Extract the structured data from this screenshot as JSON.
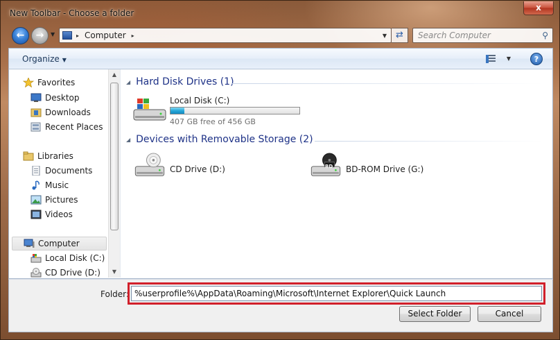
{
  "window": {
    "title": "New Toolbar - Choose a folder",
    "close_label": "x"
  },
  "nav": {
    "back_label": "←",
    "forward_label": "→",
    "history_caret": "▼"
  },
  "address": {
    "crumb": "Computer",
    "arrow": "▸",
    "dropdown": "▼"
  },
  "refresh_icon": "⇄",
  "search": {
    "placeholder": "Search Computer",
    "icon": "search-icon"
  },
  "toolbar": {
    "organize_label": "Organize",
    "caret": "▼",
    "help_label": "?"
  },
  "sidebar": {
    "favorites": [
      {
        "label": "Favorites",
        "icon": "star-icon"
      },
      {
        "label": "Desktop",
        "icon": "desktop-icon"
      },
      {
        "label": "Downloads",
        "icon": "downloads-icon"
      },
      {
        "label": "Recent Places",
        "icon": "recent-places-icon"
      }
    ],
    "libraries": [
      {
        "label": "Libraries",
        "icon": "libraries-icon"
      },
      {
        "label": "Documents",
        "icon": "documents-icon"
      },
      {
        "label": "Music",
        "icon": "music-icon"
      },
      {
        "label": "Pictures",
        "icon": "pictures-icon"
      },
      {
        "label": "Videos",
        "icon": "videos-icon"
      }
    ],
    "computer": [
      {
        "label": "Computer",
        "icon": "computer-icon"
      },
      {
        "label": "Local Disk (C:)",
        "icon": "hard-drive-icon"
      },
      {
        "label": "CD Drive (D:)",
        "icon": "cd-drive-icon"
      }
    ],
    "scroll_up": "▲",
    "scroll_down": "▼"
  },
  "content": {
    "hard_disk_group": "Hard Disk Drives (1)",
    "removable_group": "Devices with Removable Storage (2)",
    "group_toggle": "◢",
    "local_disk": {
      "name": "Local Disk (C:)",
      "free_text": "407 GB free of 456 GB",
      "used_fraction": 0.107
    },
    "cd_drive": {
      "name": "CD Drive (D:)"
    },
    "bd_drive": {
      "name": "BD-ROM Drive (G:)",
      "badge": "BD"
    }
  },
  "folder": {
    "label": "Folder:",
    "value": "%userprofile%\\AppData\\Roaming\\Microsoft\\Internet Explorer\\Quick Launch"
  },
  "buttons": {
    "select_folder": "Select Folder",
    "cancel": "Cancel"
  },
  "colors": {
    "highlight": "#d11f2a",
    "group_title": "#1e3287",
    "usage_fill": "#27a8d8"
  }
}
